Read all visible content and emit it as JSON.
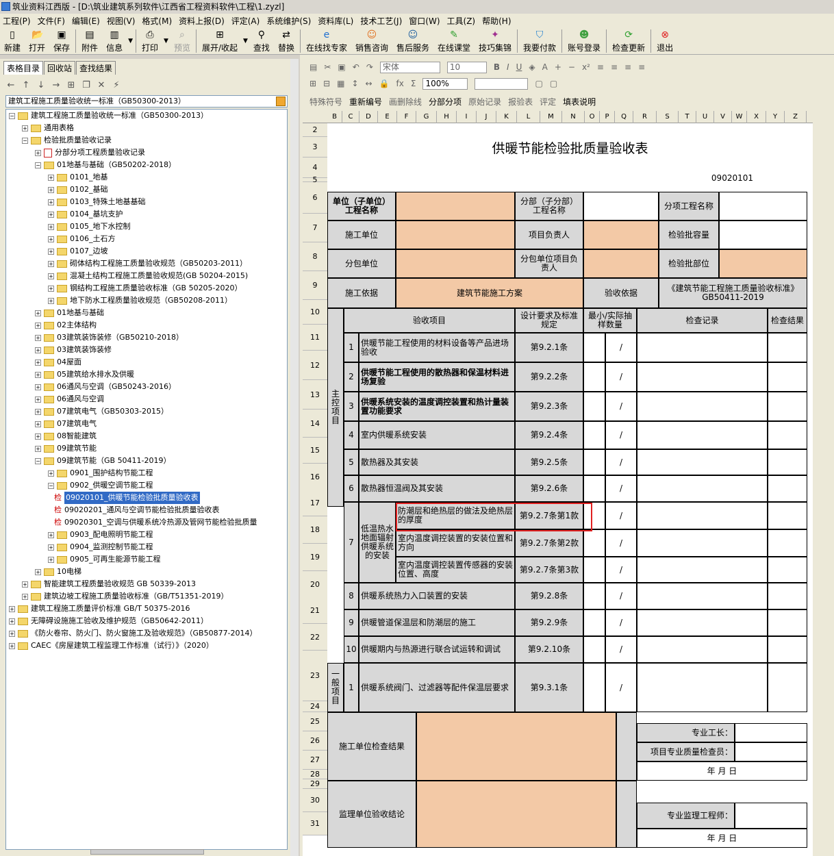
{
  "window": {
    "title": "筑业资料江西版 - [D:\\筑业建筑系列软件\\江西省工程资料软件\\工程\\1.zyzl]"
  },
  "menu": [
    "工程(P)",
    "文件(F)",
    "编辑(E)",
    "视图(V)",
    "格式(M)",
    "资料上报(D)",
    "评定(A)",
    "系统维护(S)",
    "资料库(L)",
    "技术工艺(J)",
    "窗口(W)",
    "工具(Z)",
    "帮助(H)"
  ],
  "toolbar": {
    "new": "新建",
    "open": "打开",
    "save": "保存",
    "attach": "附件",
    "info": "信息",
    "print": "打印",
    "preview": "预览",
    "expand": "展开/收起",
    "find": "查找",
    "replace": "替换",
    "expert": "在线找专家",
    "sales": "销售咨询",
    "aftersale": "售后服务",
    "classroom": "在线课堂",
    "tips": "技巧集锦",
    "pay": "我要付款",
    "login": "账号登录",
    "update": "检查更新",
    "exit": "退出"
  },
  "format": {
    "font": "宋体",
    "size": "10",
    "zoom": "100%",
    "special": "特殊符号",
    "renumber": "重新编号",
    "draw": "画删除线",
    "subitem": "分部分项",
    "orig": "原始记录",
    "report": "报验表",
    "eval": "评定",
    "fillhelp": "填表说明"
  },
  "left": {
    "tabs": [
      "表格目录",
      "回收站",
      "查找结果"
    ],
    "combo": "建筑工程施工质量验收统一标准（GB50300-2013）"
  },
  "tree": [
    "建筑工程施工质量验收统一标准（GB50300-2013）",
    "通用表格",
    "检验批质量验收记录",
    "分部分项工程质量验收记录",
    "01地基与基础（GB50202-2018）",
    "0101_地基",
    "0102_基础",
    "0103_特殊土地基基础",
    "0104_基坑支护",
    "0105_地下水控制",
    "0106_土石方",
    "0107_边坡",
    "砌体结构工程施工质量验收规范（GB50203-2011）",
    "混凝土结构工程施工质量验收规范(GB 50204-2015)",
    "钢结构工程施工质量验收标准（GB 50205-2020）",
    "地下防水工程质量验收规范（GB50208-2011）",
    "01地基与基础",
    "02主体结构",
    "03建筑装饰装修（GB50210-2018）",
    "03建筑装饰装修",
    "04屋面",
    "05建筑给水排水及供暖",
    "06通风与空调（GB50243-2016）",
    "06通风与空调",
    "07建筑电气（GB50303-2015）",
    "07建筑电气",
    "08智能建筑",
    "09建筑节能",
    "09建筑节能（GB 50411-2019）",
    "0901_围护结构节能工程",
    "0902_供暖空调节能工程",
    "09020101_供暖节能检验批质量验收表",
    "09020201_通风与空调节能检验批质量验收表",
    "09020301_空调与供暖系统冷热源及管网节能检验批质量",
    "0903_配电照明节能工程",
    "0904_监测控制节能工程",
    "0905_可再生能源节能工程",
    "10电梯",
    "智能建筑工程质量验收规范 GB 50339-2013",
    "建筑边坡工程施工质量验收标准（GB/T51351-2019）",
    "建筑工程施工质量评价标准 GB/T 50375-2016",
    "无障碍设施施工验收及维护规范（GB50642-2011）",
    "《防火卷帘、防火门、防火窗施工及验收规范》（GB50877-2014）",
    "CAEC《房屋建筑工程监理工作标准（试行）》（2020）"
  ],
  "tree_check": "检",
  "cols": [
    "B",
    "C",
    "D",
    "E",
    "F",
    "G",
    "H",
    "I",
    "J",
    "K",
    "L",
    "M",
    "N",
    "O",
    "P",
    "Q",
    "R",
    "S",
    "T",
    "U",
    "V",
    "W",
    "X",
    "Y",
    "Z"
  ],
  "rows": [
    "2",
    "3",
    "4",
    "5",
    "6",
    "7",
    "8",
    "9",
    "10",
    "11",
    "12",
    "13",
    "14",
    "15",
    "16",
    "17",
    "18",
    "19",
    "20",
    "21",
    "22",
    "23",
    "24",
    "25",
    "26",
    "27",
    "28",
    "29",
    "30",
    "31"
  ],
  "form": {
    "title": "供暖节能检验批质量验收表",
    "code": "09020101",
    "unit": "单位（子单位）工程名称",
    "subdiv": "分部（子分部）工程名称",
    "subitem": "分项工程名称",
    "constr": "施工单位",
    "pm": "项目负责人",
    "capacity": "检验批容量",
    "subcon": "分包单位",
    "subpm": "分包单位项目负责人",
    "part": "检验批部位",
    "basis": "施工依据",
    "basis_val": "建筑节能施工方案",
    "accept": "验收依据",
    "accept_val": "《建筑节能工程施工质量验收标准》GB50411-2019",
    "h_item": "验收项目",
    "h_req": "设计要求及标准规定",
    "h_min": "最小/实际抽样数量",
    "h_rec": "检查记录",
    "h_res": "检查结果",
    "main": "主控项目",
    "general": "一般项目",
    "slash": "/",
    "items": [
      {
        "n": "1",
        "t": "供暖节能工程使用的材料设备等产品进场验收",
        "r": "第9.2.1条"
      },
      {
        "n": "2",
        "t": "供暖节能工程使用的散热器和保温材料进场复验",
        "r": "第9.2.2条"
      },
      {
        "n": "3",
        "t": "供暖系统安装的温度调控装置和热计量装置功能要求",
        "r": "第9.2.3条"
      },
      {
        "n": "4",
        "t": "室内供暖系统安装",
        "r": "第9.2.4条"
      },
      {
        "n": "5",
        "t": "散热器及其安装",
        "r": "第9.2.5条"
      },
      {
        "n": "6",
        "t": "散热器恒温阀及其安装",
        "r": "第9.2.6条"
      },
      {
        "n": "7",
        "t": "低温热水地面辐射供暖系统的安装",
        "r": ""
      },
      {
        "n": "8",
        "t": "供暖系统热力入口装置的安装",
        "r": "第9.2.8条"
      },
      {
        "n": "9",
        "t": "供暖管道保温层和防潮层的施工",
        "r": "第9.2.9条"
      },
      {
        "n": "10",
        "t": "供暖期内与热源进行联合试运转和调试",
        "r": "第9.2.10条"
      },
      {
        "n": "1",
        "t": "供暖系统阀门、过滤器等配件保温层要求",
        "r": "第9.3.1条"
      }
    ],
    "sub7": [
      {
        "t": "防潮层和绝热层的做法及绝热层的厚度",
        "r": "第9.2.7条第1款"
      },
      {
        "t": "室内温度调控装置的安装位置和方向",
        "r": "第9.2.7条第2款"
      },
      {
        "t": "室内温度调控装置传感器的安装位置、高度",
        "r": "第9.2.7条第3款"
      }
    ],
    "c_result": "施工单位检查结果",
    "foreman": "专业工长：",
    "qc": "项目专业质量检查员：",
    "date": "年 月 日",
    "s_result": "监理单位验收结论",
    "engineer": "专业监理工程师："
  }
}
